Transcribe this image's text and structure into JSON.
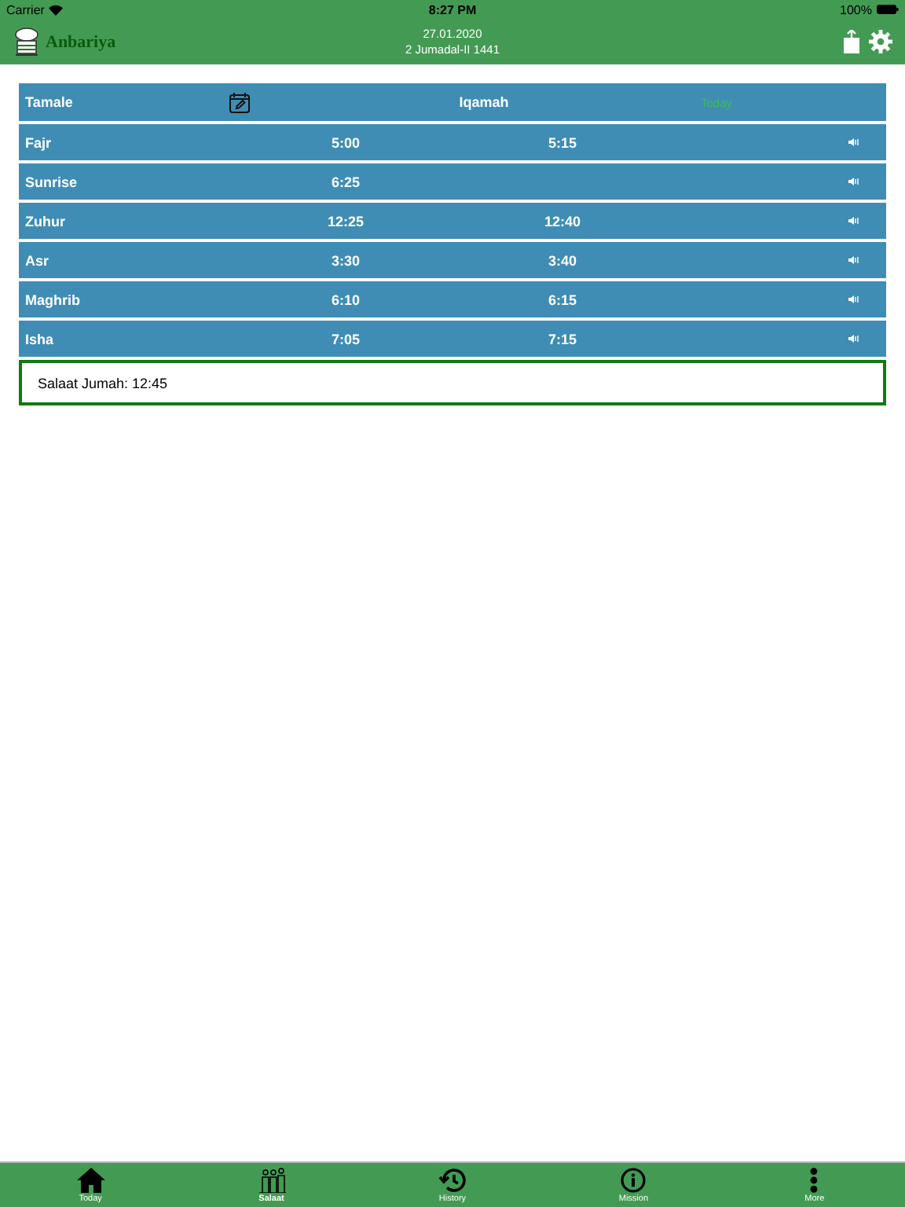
{
  "status_bar": {
    "carrier": "Carrier",
    "time": "8:27 PM",
    "battery": "100%"
  },
  "header": {
    "app_name": "Anbariya",
    "date": "27.01.2020",
    "hijri_date": "2 Jumadal-II 1441"
  },
  "table": {
    "columns": {
      "city": "Tamale",
      "iqamah": "Iqamah",
      "today": "Today"
    },
    "rows": [
      {
        "name": "Fajr",
        "adhan": "5:00",
        "iqamah": "5:15"
      },
      {
        "name": "Sunrise",
        "adhan": "6:25"
      },
      {
        "name": "Zuhur",
        "adhan": "12:25",
        "iqamah": "12:40"
      },
      {
        "name": "Asr",
        "adhan": "3:30",
        "iqamah": "3:40"
      },
      {
        "name": "Maghrib",
        "adhan": "6:10",
        "iqamah": "6:15"
      },
      {
        "name": "Isha",
        "adhan": "7:05",
        "iqamah": "7:15"
      }
    ]
  },
  "jumah": "Salaat Jumah: 12:45",
  "tab_bar": [
    {
      "kind": "home",
      "label": "Today",
      "selected": false
    },
    {
      "kind": "salaat",
      "label": "Salaat",
      "selected": true
    },
    {
      "kind": "history",
      "label": "History",
      "selected": false
    },
    {
      "kind": "info",
      "label": "Mission",
      "selected": false
    },
    {
      "kind": "more",
      "label": "More",
      "selected": false
    }
  ]
}
